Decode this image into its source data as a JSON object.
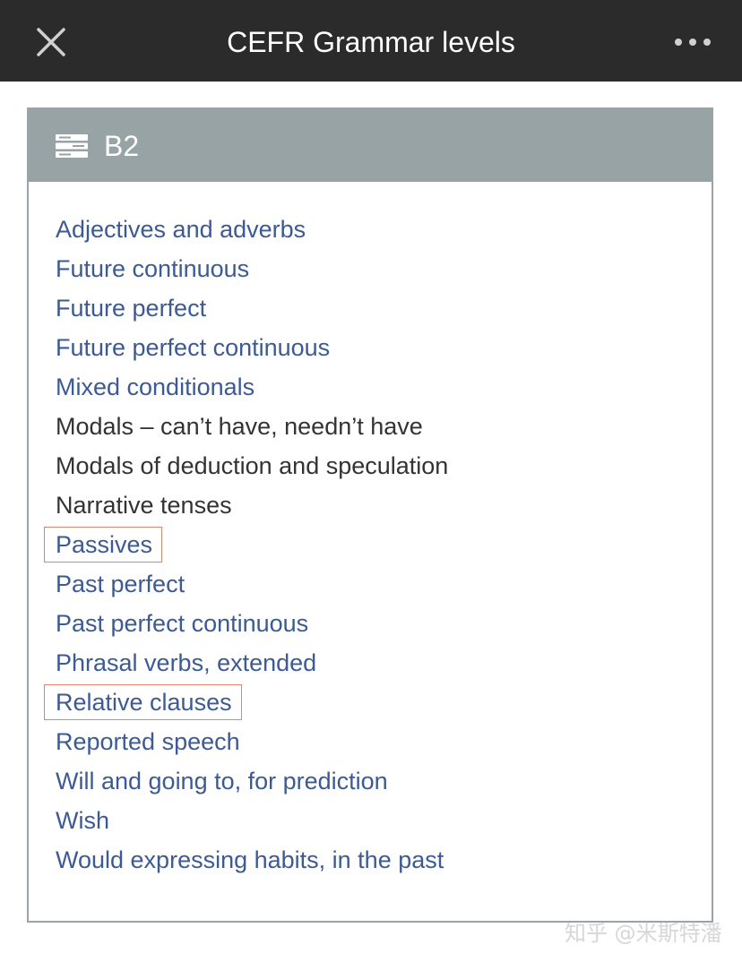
{
  "app": {
    "title": "CEFR Grammar levels",
    "close_icon": "close-icon",
    "more_icon": "more-options-icon"
  },
  "panel": {
    "level": "B2",
    "level_icon": "stack-list-icon",
    "topics": [
      {
        "label": "Adjectives and adverbs",
        "link": true,
        "highlighted": false
      },
      {
        "label": "Future continuous",
        "link": true,
        "highlighted": false
      },
      {
        "label": "Future perfect",
        "link": true,
        "highlighted": false
      },
      {
        "label": "Future perfect continuous",
        "link": true,
        "highlighted": false
      },
      {
        "label": "Mixed conditionals",
        "link": true,
        "highlighted": false
      },
      {
        "label": "Modals – can’t have, needn’t have",
        "link": false,
        "highlighted": false
      },
      {
        "label": "Modals of deduction and speculation",
        "link": false,
        "highlighted": false
      },
      {
        "label": "Narrative tenses",
        "link": false,
        "highlighted": false
      },
      {
        "label": "Passives",
        "link": true,
        "highlighted": true
      },
      {
        "label": "Past perfect",
        "link": true,
        "highlighted": false
      },
      {
        "label": "Past perfect continuous",
        "link": true,
        "highlighted": false
      },
      {
        "label": "Phrasal verbs, extended",
        "link": true,
        "highlighted": false
      },
      {
        "label": "Relative clauses",
        "link": true,
        "highlighted": true
      },
      {
        "label": "Reported speech",
        "link": true,
        "highlighted": false
      },
      {
        "label": "Will and going to, for prediction",
        "link": true,
        "highlighted": false
      },
      {
        "label": "Wish",
        "link": true,
        "highlighted": false
      },
      {
        "label": "Would expressing habits, in the past",
        "link": true,
        "highlighted": false
      }
    ]
  },
  "watermark": "知乎 @米斯特潘",
  "colors": {
    "topbar": "#2b2b2b",
    "panel_header": "#98a3a5",
    "link": "#3c5a93",
    "plain_text": "#333333",
    "highlight_border": "#e0846c"
  }
}
